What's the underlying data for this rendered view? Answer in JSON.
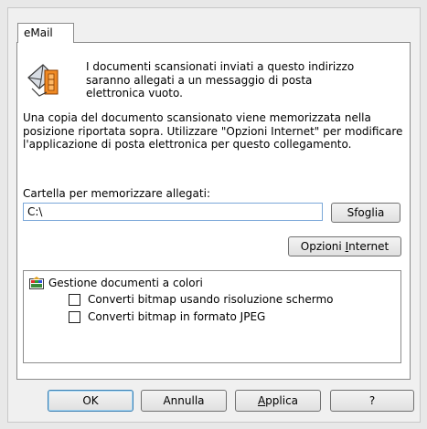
{
  "tab": {
    "label": "eMail"
  },
  "intro_text": "I documenti scansionati inviati a questo indirizzo saranno allegati a un messaggio di posta elettronica vuoto.",
  "description_text": "Una copia del documento scansionato viene memorizzata nella posizione riportata sopra. Utilizzare \"Opzioni Internet\" per modificare l'applicazione di posta elettronica per questo collegamento.",
  "folder": {
    "label": "Cartella per memorizzare allegati:",
    "value": "C:\\"
  },
  "buttons": {
    "browse": "Sfoglia",
    "internet_options_prefix": "Opzioni ",
    "internet_options_mnemonic": "I",
    "internet_options_suffix": "nternet",
    "ok": "OK",
    "cancel": "Annulla",
    "apply_mnemonic": "A",
    "apply_suffix": "pplica",
    "help": "?"
  },
  "color_management": {
    "title": "Gestione documenti a colori",
    "options": [
      {
        "label": "Converti bitmap usando risoluzione schermo",
        "checked": false
      },
      {
        "label": "Converti bitmap in formato JPEG",
        "checked": false
      }
    ]
  },
  "icons": {
    "email": "email-attachment-icon",
    "color": "color-management-icon"
  }
}
